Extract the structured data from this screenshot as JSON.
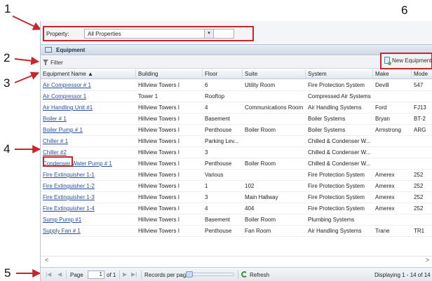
{
  "callouts": [
    "1",
    "2",
    "3",
    "4",
    "5",
    "6"
  ],
  "property": {
    "label": "Property:",
    "value": "All Properties"
  },
  "panel": {
    "title": "Equipment"
  },
  "toolbar": {
    "filter_label": "Filter",
    "new_equipment_label": "New Equipment"
  },
  "columns": [
    "Equipment Name ▲",
    "Building",
    "Floor",
    "Suite",
    "System",
    "Make",
    "Mode"
  ],
  "rows": [
    [
      "Air Compressor # 1",
      "Hillview Towers I",
      "6",
      "Utility Room",
      "Fire Protection System",
      "Devill",
      "547"
    ],
    [
      "Air Compressor 1",
      "Tower 1",
      "Rooftop",
      "",
      "Compressed Air Systems",
      "",
      ""
    ],
    [
      "Air Handling Unit #1",
      "Hillview Towers I",
      "4",
      "Communications Room",
      "Air Handling Systems",
      "Ford",
      "FJ13"
    ],
    [
      "Boiler # 1",
      "Hillview Towers I",
      "Basement",
      "",
      "Boiler Systems",
      "Bryan",
      "BT-2"
    ],
    [
      "Boiler Pump # 1",
      "Hillview Towers I",
      "Penthouse",
      "Boiler Room",
      "Boiler Systems",
      "Armstrong",
      "ARG"
    ],
    [
      "Chiller # 1",
      "Hillview Towers I",
      "Parking Lev...",
      "",
      "Chilled & Condenser W...",
      "",
      ""
    ],
    [
      "Chiller #2",
      "Hillview Towers I",
      "3",
      "",
      "Chilled & Condenser W...",
      "",
      ""
    ],
    [
      "Condenser Water Pump # 1",
      "Hillview Towers I",
      "Penthouse",
      "Boiler Room",
      "Chilled & Condenser W...",
      "",
      ""
    ],
    [
      "Fire Extinguisher 1-1",
      "Hillview Towers I",
      "Various",
      "",
      "Fire Protection System",
      "Amerex",
      "252"
    ],
    [
      "Fire Extinguisher 1-2",
      "Hillview Towers I",
      "1",
      "102",
      "Fire Protection System",
      "Amerex",
      "252"
    ],
    [
      "Fire Extinguisher 1-3",
      "Hillview Towers I",
      "3",
      "Main Hallway",
      "Fire Protection System",
      "Amerex",
      "252"
    ],
    [
      "Fire Extinguisher 1-4",
      "Hillview Towers I",
      "4",
      "404",
      "Fire Protection System",
      "Amerex",
      "252"
    ],
    [
      "Sump Pump #1",
      "Hillview Towers I",
      "Basement",
      "Boiler Room",
      "Plumbing Systems",
      "",
      ""
    ],
    [
      "Supply Fan # 1",
      "Hillview Towers I",
      "Penthouse",
      "Fan Room",
      "Air Handling Systems",
      "Trane",
      "TR1"
    ]
  ],
  "scroll": {
    "left": "<",
    "right": ">"
  },
  "pager": {
    "first": "|◀",
    "prev": "◀",
    "page_label": "Page",
    "page_value": "1",
    "of_label": "of 1",
    "next": "▶",
    "last": "▶|",
    "records_label": "Records per page:",
    "refresh_label": "Refresh",
    "display_text": "Displaying 1 - 14 of 14"
  },
  "colors": {
    "callout_red": "#c8262c",
    "link_blue": "#2b4fa0"
  }
}
